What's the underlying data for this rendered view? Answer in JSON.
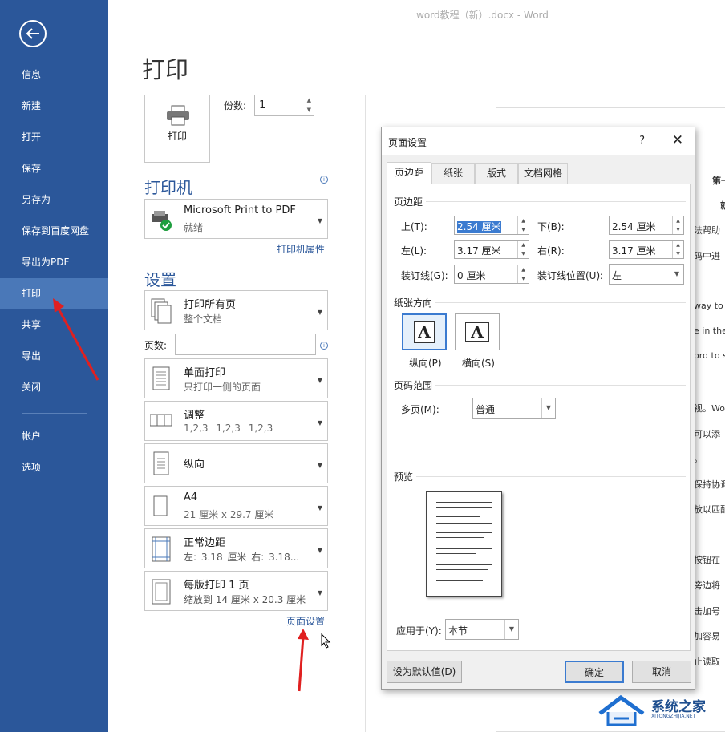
{
  "window_title": "word教程（新）.docx - Word",
  "nav": {
    "back": "←",
    "items": [
      "信息",
      "新建",
      "打开",
      "保存",
      "另存为",
      "保存到百度网盘",
      "导出为PDF",
      "打印",
      "共享",
      "导出",
      "关闭",
      "帐户",
      "选项"
    ]
  },
  "print": {
    "title": "打印",
    "print_button": "打印",
    "copies_label": "份数:",
    "copies_value": "1"
  },
  "printer": {
    "heading": "打印机",
    "name": "Microsoft Print to PDF",
    "status": "就绪",
    "properties_link": "打印机属性"
  },
  "settings": {
    "heading": "设置",
    "pages_label": "页数:",
    "page_setup_link": "页面设置",
    "options": [
      {
        "l1": "打印所有页",
        "l2": "整个文档"
      },
      {
        "l1": "单面打印",
        "l2": "只打印一侧的页面"
      },
      {
        "l1": "调整",
        "l2": "1,2,3    1,2,3    1,2,3"
      },
      {
        "l1": "纵向",
        "l2": ""
      },
      {
        "l1": "A4",
        "l2": "21 厘米 x 29.7 厘米"
      },
      {
        "l1": "正常边距",
        "l2": "左: 3.18 厘米    右: 3.18..."
      },
      {
        "l1": "每版打印 1 页",
        "l2": "缩放到 14 厘米 x 20.3 厘米"
      }
    ]
  },
  "doc_preview": {
    "lines": [
      "第一",
      "就",
      "法帮助",
      "码中进",
      "way to",
      "e in the",
      "ord to s",
      "视。Wo",
      "可以添",
      "。",
      "保持协调",
      "放以匹配",
      "按钮在",
      "旁边将",
      "击加号",
      "加容易",
      "止读取"
    ]
  },
  "dialog": {
    "title": "页面设置",
    "help": "?",
    "close": "✕",
    "tabs": [
      "页边距",
      "纸张",
      "版式",
      "文档网格"
    ],
    "margins_group": "页边距",
    "top_label": "上(T):",
    "top_value": "2.54 厘米",
    "bottom_label": "下(B):",
    "bottom_value": "2.54 厘米",
    "left_label": "左(L):",
    "left_value": "3.17 厘米",
    "right_label": "右(R):",
    "right_value": "3.17 厘米",
    "gutter_label": "装订线(G):",
    "gutter_value": "0 厘米",
    "gutter_pos_label": "装订线位置(U):",
    "gutter_pos_value": "左",
    "orientation_group": "纸张方向",
    "portrait": "纵向(P)",
    "landscape": "横向(S)",
    "orient_glyph": "A",
    "pages_group": "页码范围",
    "multiple_label": "多页(M):",
    "multiple_value": "普通",
    "preview_group": "预览",
    "apply_label": "应用于(Y):",
    "apply_value": "本节",
    "default_btn": "设为默认值(D)",
    "ok_btn": "确定",
    "cancel_btn": "取消"
  },
  "watermark": {
    "title": "系统之家",
    "sub": "XITONGZHIJIA.NET"
  },
  "colors": {
    "sidebar": "#2b579a",
    "accent": "#2b579a",
    "annotation": "#e02020"
  }
}
